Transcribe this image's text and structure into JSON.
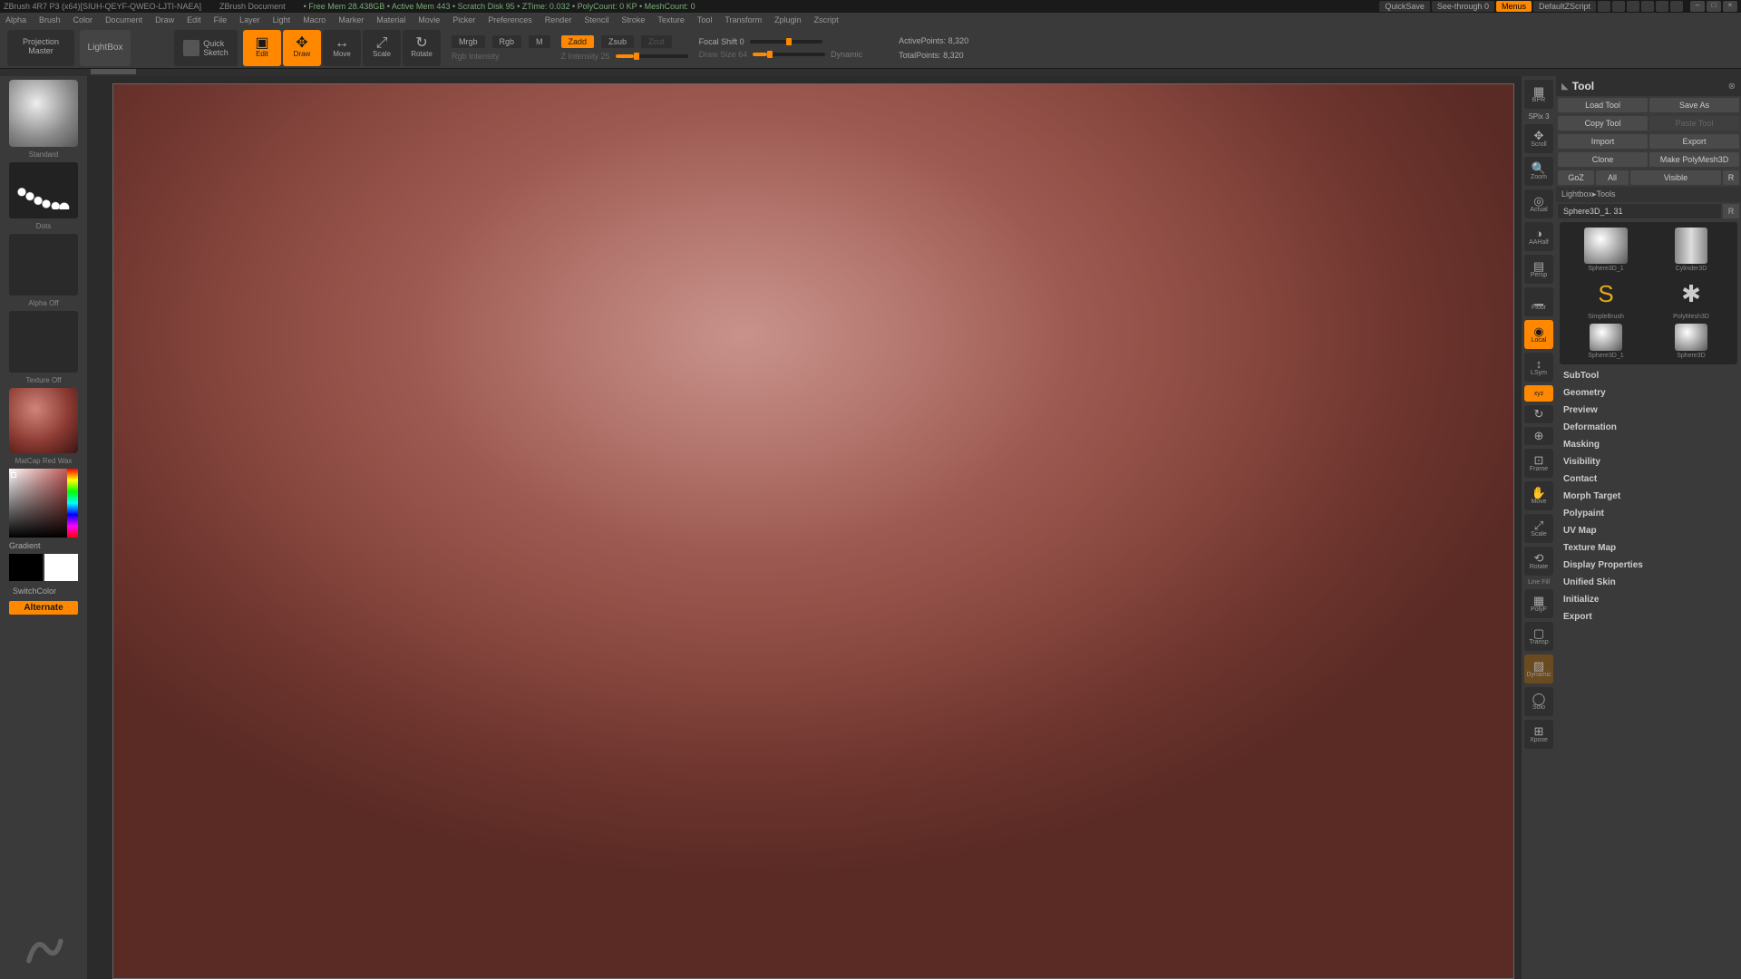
{
  "title": {
    "app": "ZBrush 4R7 P3 (x64)[SIUH-QEYF-QWEO-LJTI-NAEA]",
    "doc": "ZBrush Document",
    "mem": "• Free Mem 28.438GB • Active Mem 443 • Scratch Disk 95 • ZTime: 0.032 • PolyCount: 0 KP • MeshCount: 0",
    "quicksave": "QuickSave",
    "seethrough": "See-through  0",
    "menus": "Menus",
    "script": "DefaultZScript"
  },
  "menu": [
    "Alpha",
    "Brush",
    "Color",
    "Document",
    "Draw",
    "Edit",
    "File",
    "Layer",
    "Light",
    "Macro",
    "Marker",
    "Material",
    "Movie",
    "Picker",
    "Preferences",
    "Render",
    "Stencil",
    "Stroke",
    "Texture",
    "Tool",
    "Transform",
    "Zplugin",
    "Zscript"
  ],
  "toolbar": {
    "projection": "Projection\nMaster",
    "lightbox": "LightBox",
    "qsketch": "Quick\nSketch",
    "modes": [
      {
        "label": "Edit",
        "icon": "▣"
      },
      {
        "label": "Draw",
        "icon": "✥"
      },
      {
        "label": "Move",
        "icon": "↔"
      },
      {
        "label": "Scale",
        "icon": "⤢"
      },
      {
        "label": "Rotate",
        "icon": "↻"
      }
    ],
    "mrgb": "Mrgb",
    "rgb": "Rgb",
    "mlab": "M",
    "rgbint": "Rgb Intensity",
    "zadd": "Zadd",
    "zsub": "Zsub",
    "zcut": "Zcut",
    "zint": "Z Intensity 25",
    "focal": "Focal Shift 0",
    "drawsize": "Draw Size 64",
    "dynamic": "Dynamic",
    "active": "ActivePoints: 8,320",
    "total": "TotalPoints: 8,320"
  },
  "left": {
    "brush": "Standard",
    "stroke": "Dots",
    "alpha": "Alpha Off",
    "texture": "Texture Off",
    "material": "MatCap Red Wax",
    "gradient": "Gradient",
    "switch": "SwitchColor",
    "alt": "Alternate"
  },
  "rstrip": {
    "spix": "SPix 3",
    "items": [
      {
        "l": "BPR",
        "i": "▦"
      },
      {
        "l": "Scroll",
        "i": "✥"
      },
      {
        "l": "Zoom",
        "i": "🔍"
      },
      {
        "l": "Actual",
        "i": "◎"
      },
      {
        "l": "AAHalf",
        "i": "◑"
      },
      {
        "l": "Persp",
        "i": "▤"
      },
      {
        "l": "Floor",
        "i": "▁"
      },
      {
        "l": "Local",
        "i": "◉"
      },
      {
        "l": "LSym",
        "i": "↕"
      },
      {
        "l": "Xyz",
        "i": "xyz"
      },
      {
        "l": "",
        "i": "↻"
      },
      {
        "l": "",
        "i": "⊕"
      },
      {
        "l": "Frame",
        "i": "⊡"
      },
      {
        "l": "Move",
        "i": "✋"
      },
      {
        "l": "Scale",
        "i": "⤢"
      },
      {
        "l": "Rotate",
        "i": "⟲"
      }
    ],
    "linefill": "Line Fill",
    "items2": [
      {
        "l": "PolyF",
        "i": "▦"
      },
      {
        "l": "Transp",
        "i": "▢"
      },
      {
        "l": "Dynamic",
        "i": "▨"
      },
      {
        "l": "Solo",
        "i": "◯"
      },
      {
        "l": "Xpose",
        "i": "⊞"
      }
    ]
  },
  "tool": {
    "title": "Tool",
    "row1": [
      "Load Tool",
      "Save As"
    ],
    "row2": [
      "Copy Tool",
      "Paste Tool"
    ],
    "row3": [
      "Import",
      "Export"
    ],
    "row4": [
      "Clone",
      "Make PolyMesh3D"
    ],
    "row5": [
      "GoZ",
      "All",
      "Visible",
      "R"
    ],
    "lightbox": "Lightbox▸Tools",
    "toolname": "Sphere3D_1. 31",
    "r": "R",
    "thumbs": [
      {
        "l": "Sphere3D_1",
        "c": "sphere-g"
      },
      {
        "l": "Cylinder3D",
        "c": "cyl-g"
      },
      {
        "l": "PolyMesh3D",
        "c": "star-g",
        "t": "✱"
      },
      {
        "l": "SimpleBrush",
        "c": "brush-g",
        "t": "S"
      },
      {
        "l": "Sphere3D",
        "c": "sphere-g"
      },
      {
        "l": "Sphere3D_1",
        "c": "sphere-g"
      }
    ],
    "sections": [
      "SubTool",
      "Geometry",
      "Preview",
      "Deformation",
      "Masking",
      "Visibility",
      "Contact",
      "Morph Target",
      "Polypaint",
      "UV Map",
      "Texture Map",
      "Display Properties",
      "Unified Skin",
      "Initialize",
      "Export"
    ]
  }
}
